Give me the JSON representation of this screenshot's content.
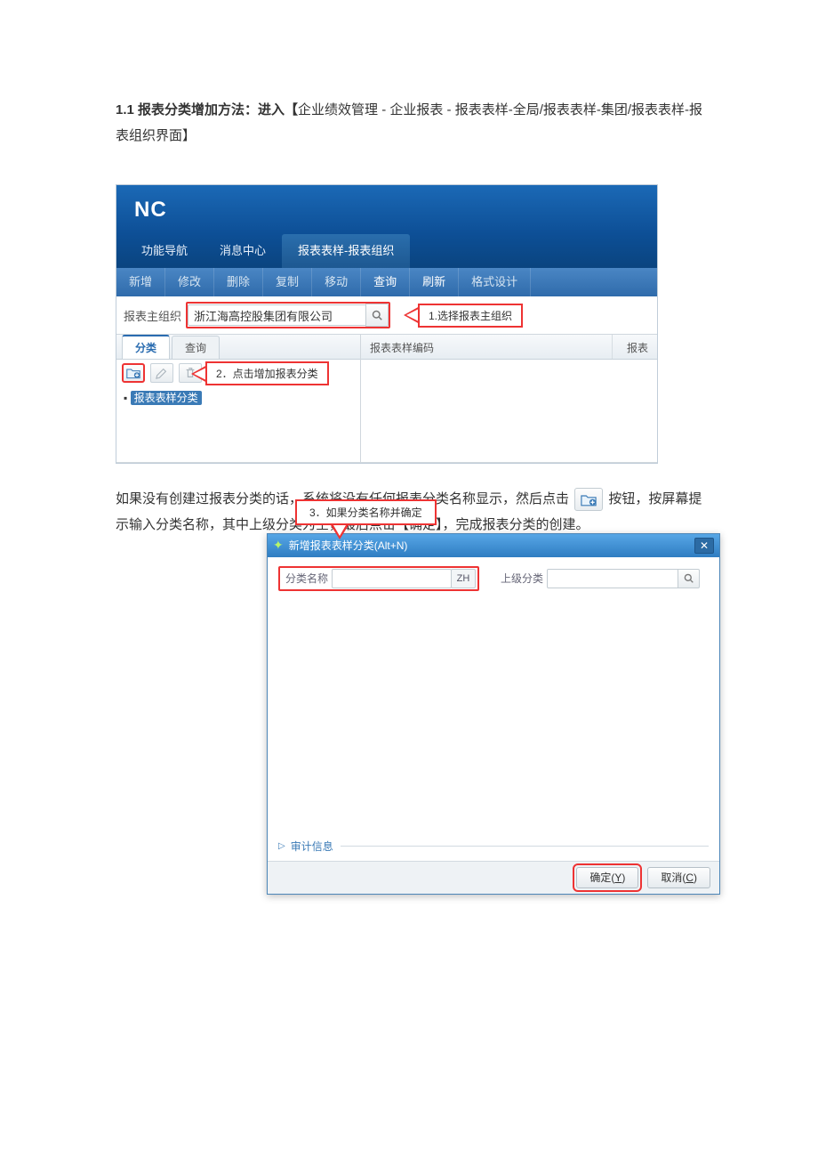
{
  "heading": {
    "bold": "1.1 报表分类增加方法：进入【",
    "rest": "企业绩效管理 - 企业报表 - 报表表样-全局/报表表样-集团/报表表样-报表组织界面】"
  },
  "shot1": {
    "logo": "NC",
    "nav": {
      "func": "功能导航",
      "msg": "消息中心",
      "active": "报表表样-报表组织"
    },
    "toolbar": {
      "new": "新增",
      "edit": "修改",
      "del": "删除",
      "copy": "复制",
      "move": "移动",
      "query": "查询",
      "refresh": "刷新",
      "format": "格式设计"
    },
    "org": {
      "label": "报表主组织",
      "value": "浙江海高控股集团有限公司"
    },
    "callout1": "1.选择报表主组织",
    "subtabs": {
      "cat": "分类",
      "query": "查询"
    },
    "callout2": "2．点击增加报表分类",
    "tree_root": "报表表样分类",
    "grid": {
      "col1": "报表表样编码",
      "col2": "报表"
    }
  },
  "mid_para": {
    "p1": " 如果没有创建过报表分类的话，系统将没有任何报表分类名称显示，然后点击",
    "p2": "按钮，按屏幕提示输入分类名称，其中上级分类为空，最后点击【确定】，完成报表分类的创建。"
  },
  "shot2": {
    "callout3": "3．如果分类名称并确定",
    "title": "新增报表表样分类(Alt+N)",
    "name_label": "分类名称",
    "zh": "ZH",
    "parent_label": "上级分类",
    "audit": "审计信息",
    "ok": "确定(Y)",
    "ok_key": "Y",
    "ok_pre": "确定(",
    "cancel_pre": "取消(",
    "cancel_key": "C",
    "paren_close": ")"
  }
}
